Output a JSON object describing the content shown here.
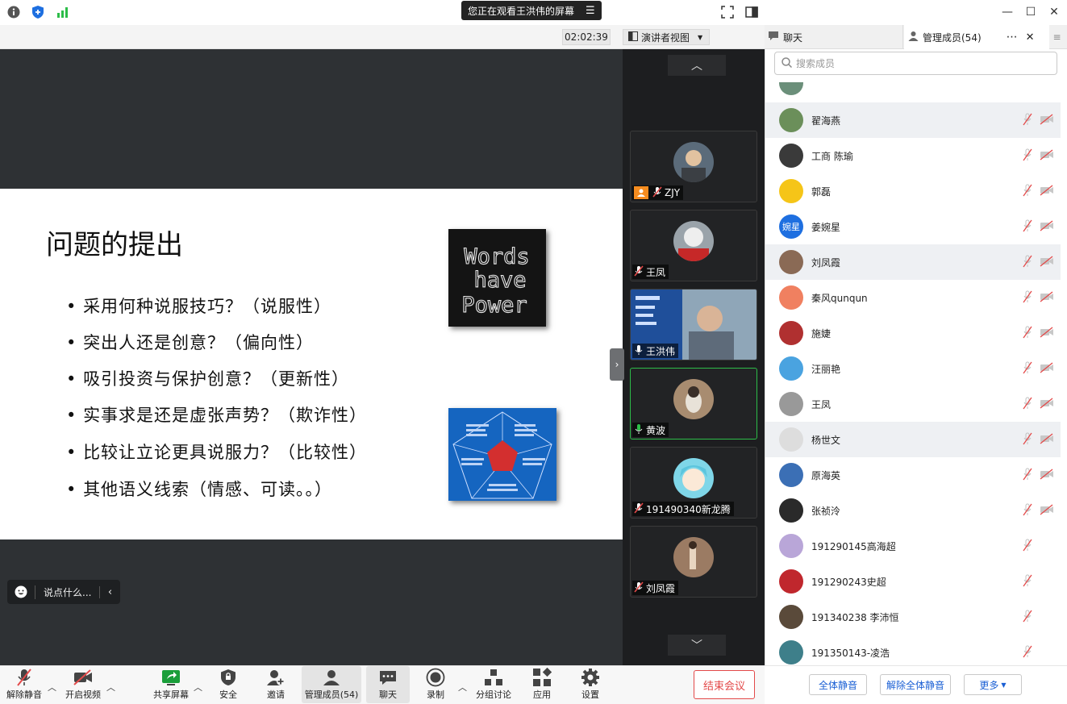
{
  "titlebar": {
    "banner_text": "您正在观看王洪伟的屏幕",
    "banner_menu_icon": "list-icon",
    "minimize_icon": "minimize-icon",
    "maximize_icon": "maximize-icon",
    "close_icon": "close-icon"
  },
  "toolbar": {
    "timer": "02:02:39",
    "view_mode": "演讲者视图"
  },
  "slide": {
    "title": "问题的提出",
    "bullets": [
      "采用何种说服技巧？（说服性）",
      "突出人还是创意？（偏向性）",
      "吸引投资与保护创意？（更新性）",
      "实事求是还是虚张声势？（欺诈性）",
      "比较让立论更具说服力？（比较性）",
      "其他语义线索（情感、可读。。）"
    ],
    "image1_words": [
      "Words",
      "have",
      "Power"
    ]
  },
  "chat_input": {
    "placeholder": "说点什么..."
  },
  "gallery": [
    {
      "name": "ZJY"
    },
    {
      "name": "王凤"
    },
    {
      "name": "王洪伟"
    },
    {
      "name": "黄波"
    },
    {
      "name": "191490340新龙腾"
    },
    {
      "name": "刘凤霞"
    }
  ],
  "bottombar": {
    "unmute": "解除静音",
    "start_video": "开启视频",
    "share_screen": "共享屏幕",
    "security": "安全",
    "invite": "邀请",
    "manage_members": "管理成员(54)",
    "chat": "聊天",
    "record": "录制",
    "breakout": "分组讨论",
    "apps": "应用",
    "settings": "设置",
    "end_meeting": "结束会议"
  },
  "panel": {
    "tab_chat": "聊天",
    "tab_members": "管理成员(54)",
    "search_placeholder": "搜索成员",
    "members": [
      {
        "name": "翟海燕",
        "color": "#6b8f5a"
      },
      {
        "name": "工商 陈瑜",
        "color": "#3a3a3a"
      },
      {
        "name": "郭磊",
        "color": "#f5c518"
      },
      {
        "name": "姜婉星",
        "color": "#1e6fe0",
        "initials": "婉星"
      },
      {
        "name": "刘凤霞",
        "color": "#8a6a55"
      },
      {
        "name": "秦风qunqun",
        "color": "#f08060"
      },
      {
        "name": "施婕",
        "color": "#b03030"
      },
      {
        "name": "汪丽艳",
        "color": "#4aa3e0"
      },
      {
        "name": "王凤",
        "color": "#999999"
      },
      {
        "name": "杨世文",
        "color": "#dddddd"
      },
      {
        "name": "原海英",
        "color": "#3b6fb5"
      },
      {
        "name": "张祯泠",
        "color": "#2a2a2a"
      },
      {
        "name": "191290145高海超",
        "color": "#b9a6d8"
      },
      {
        "name": "191290243史超",
        "color": "#c0272d"
      },
      {
        "name": "191340238 李沛恒",
        "color": "#5a4a3a"
      },
      {
        "name": "191350143-凌浩",
        "color": "#3e7f8a"
      }
    ],
    "mute_all": "全体静音",
    "unmute_all": "解除全体静音",
    "more": "更多"
  }
}
